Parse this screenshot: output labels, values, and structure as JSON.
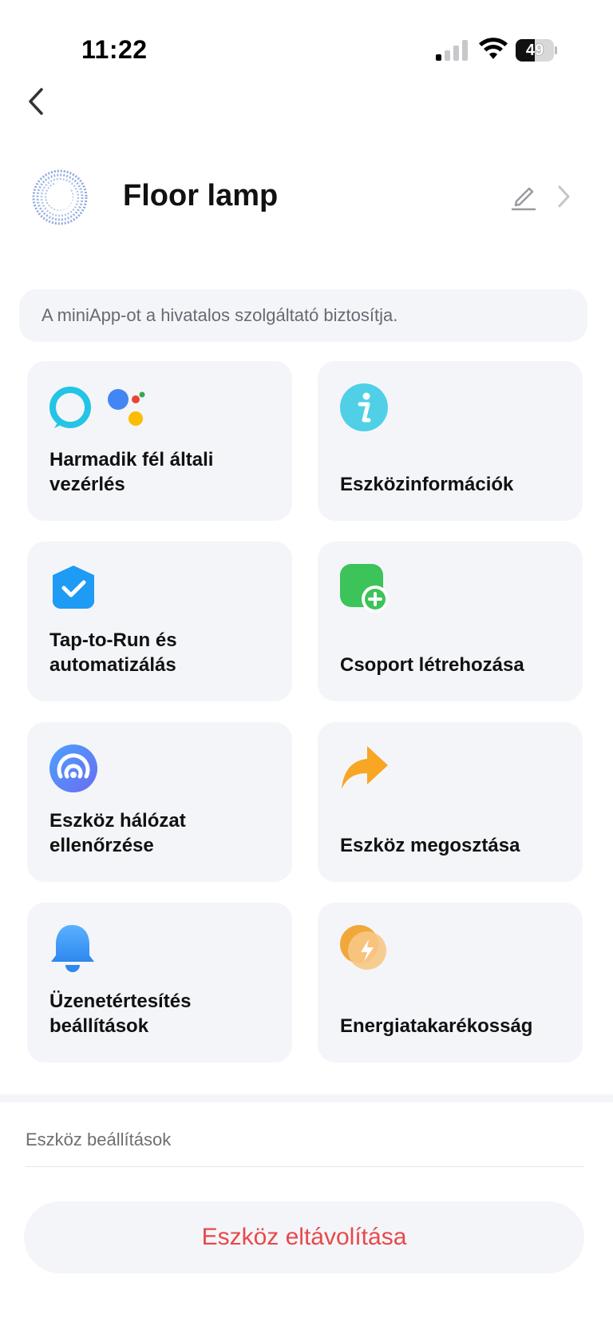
{
  "status_bar": {
    "time": "11:22",
    "battery_level": "49",
    "battery_fraction": 0.49,
    "signal_bars_active": 1,
    "signal_bars_total": 4
  },
  "icons": {
    "back": "chevron-left-icon",
    "edit": "pencil-icon",
    "detail": "chevron-right-icon"
  },
  "device": {
    "name": "Floor lamp"
  },
  "notice": {
    "text": "A miniApp-ot a hivatalos szolgáltató biztosítja."
  },
  "features": [
    {
      "id": "third-party",
      "label": "Harmadik fél általi vezérlés",
      "icon": "alexa-google-assistant-icon"
    },
    {
      "id": "device-info",
      "label": "Eszközinformációk",
      "icon": "info-icon"
    },
    {
      "id": "tap-to-run",
      "label": "Tap-to-Run és automatizálás",
      "icon": "shield-check-icon"
    },
    {
      "id": "create-group",
      "label": "Csoport létrehozása",
      "icon": "group-add-icon"
    },
    {
      "id": "network-check",
      "label": "Eszköz hálózat ellenőrzése",
      "icon": "signal-check-icon"
    },
    {
      "id": "share-device",
      "label": "Eszköz megosztása",
      "icon": "share-arrow-icon"
    },
    {
      "id": "notifications",
      "label": "Üzenetértesítés beállítások",
      "icon": "bell-icon"
    },
    {
      "id": "energy-saving",
      "label": "Energiatakarékosság",
      "icon": "energy-icon"
    }
  ],
  "settings": {
    "label": "Eszköz beállítások"
  },
  "remove": {
    "label": "Eszköz eltávolítása",
    "color": "#e8484a"
  },
  "colors": {
    "card_background": "#f4f5f9",
    "info_blue": "#4fd0e6",
    "automation_blue": "#1e9bf5",
    "group_green": "#3cc35a",
    "network_blue": "#5b7ff5",
    "share_orange": "#f8a623",
    "bell_blue": "#3d9cf2",
    "energy_orange": "#f2a73a"
  }
}
